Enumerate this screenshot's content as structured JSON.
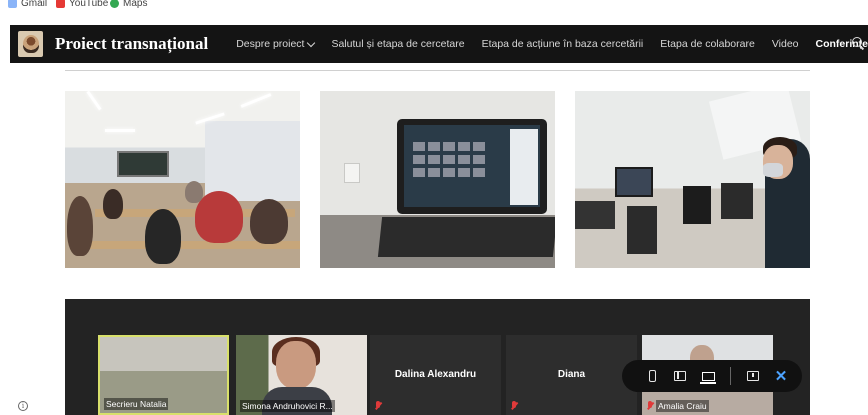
{
  "bookmarks": [
    {
      "label": "Gmail",
      "icon": "gmail-icon"
    },
    {
      "label": "YouTube",
      "icon": "youtube-icon"
    },
    {
      "label": "Maps",
      "icon": "maps-icon"
    }
  ],
  "nav": {
    "brand": "Proiect transnațional",
    "items": [
      {
        "label": "Despre proiect",
        "has_dropdown": true
      },
      {
        "label": "Salutul și etapa de cercetare"
      },
      {
        "label": "Etapa de acțiune în baza cercetării"
      },
      {
        "label": "Etapa de colaborare"
      },
      {
        "label": "Video"
      },
      {
        "label": "Conferințe",
        "active": true
      }
    ]
  },
  "meeting": {
    "tiles": [
      {
        "name": "Secrieru Natalia",
        "type": "video",
        "speaking": true
      },
      {
        "name": "Simona Andruhovici R...",
        "type": "video"
      },
      {
        "name": "Dalina Alexandru",
        "type": "name-only",
        "muted": true
      },
      {
        "name": "Diana",
        "type": "name-only",
        "muted": true
      },
      {
        "name": "Amalia Craiu",
        "type": "video",
        "muted": true
      }
    ]
  },
  "device_toolbar": {
    "buttons": [
      "phone-icon",
      "tablet-icon",
      "laptop-icon",
      "comment-icon",
      "close-icon"
    ],
    "close_symbol": "✕"
  },
  "info_symbol": "i",
  "colors": {
    "nav_background": "#141414",
    "meeting_background": "#232323",
    "active_speaker_border": "#d8e06b",
    "close_accent": "#4da3ff"
  }
}
